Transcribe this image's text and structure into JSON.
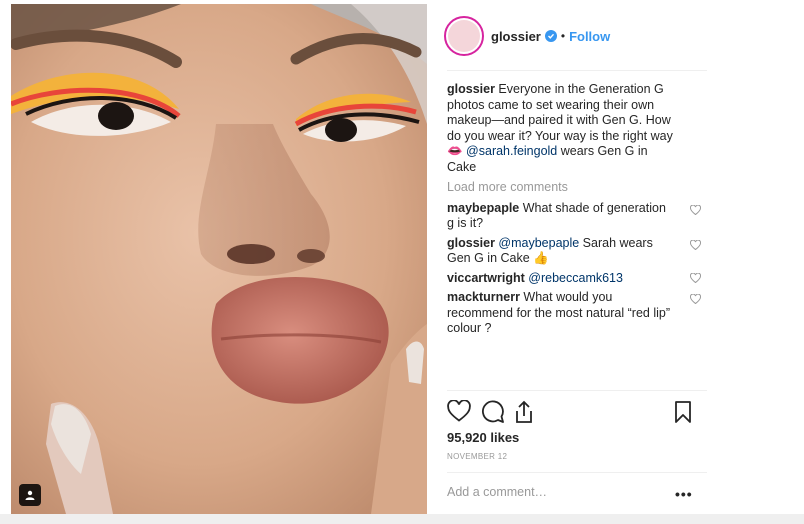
{
  "post": {
    "username": "glossier",
    "dot": "•",
    "follow_label": "Follow",
    "caption": {
      "username": "glossier",
      "text": " Everyone in the Generation G photos came to set wearing their own makeup—and paired it with Gen G. How do you wear it? Your way is the right way 👄 ",
      "mention": "@sarah.feingold",
      "text_after": " wears Gen G in Cake"
    },
    "load_more": "Load more comments",
    "comments": [
      {
        "username": "maybepaple",
        "mention": "",
        "text": " What shade of generation g is it?"
      },
      {
        "username": "glossier",
        "mention": " @maybepaple",
        "text": " Sarah wears Gen G in Cake 👍"
      },
      {
        "username": "viccartwright",
        "mention": " @rebeccamk613",
        "text": ""
      },
      {
        "username": "mackturnerr",
        "mention": "",
        "text": " What would you recommend for the most natural “red lip” colour ?"
      }
    ],
    "likes": "95,920 likes",
    "date": "NOVEMBER 12",
    "add_comment_placeholder": "Add a comment…",
    "more_label": "•••"
  },
  "icons": {
    "heart": "heart-icon",
    "comment": "comment-icon",
    "share": "share-icon",
    "bookmark": "bookmark-icon",
    "verified": "verified-badge-icon",
    "tag": "user-tag-icon"
  },
  "colors": {
    "accent": "#3897f0",
    "mention": "#003569",
    "muted": "#999999",
    "text": "#262626"
  }
}
